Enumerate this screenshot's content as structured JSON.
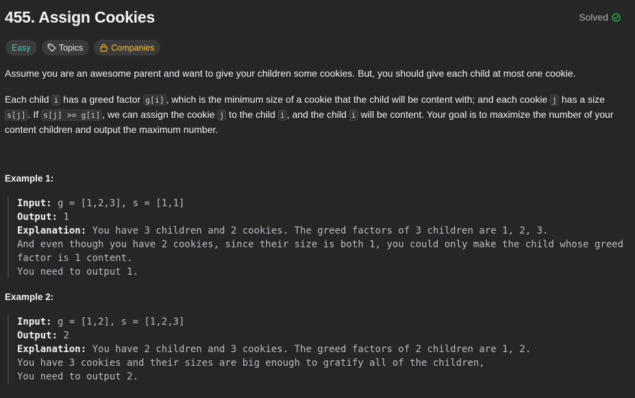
{
  "problem": {
    "title": "455. Assign Cookies",
    "status": "Solved",
    "colors": {
      "easy": "#46c6c2",
      "companies": "#ffc01e",
      "solved_check": "#2cbb5d"
    }
  },
  "tags": {
    "difficulty": "Easy",
    "topics": "Topics",
    "companies": "Companies"
  },
  "description": {
    "p1": "Assume you are an awesome parent and want to give your children some cookies. But, you should give each child at most one cookie.",
    "p2": {
      "t1": "Each child ",
      "c1": "i",
      "t2": " has a greed factor ",
      "c2": "g[i]",
      "t3": ", which is the minimum size of a cookie that the child will be content with; and each cookie ",
      "c3": "j",
      "t4": " has a size ",
      "c4": "s[j]",
      "t5": ". If ",
      "c5": "s[j] >= g[i]",
      "t6": ", we can assign the cookie ",
      "c6": "j",
      "t7": " to the child ",
      "c7": "i",
      "t8": ", and the child ",
      "c8": "i",
      "t9": " will be content. Your goal is to maximize the number of your content children and output the maximum number."
    }
  },
  "examples": [
    {
      "title": "Example 1:",
      "input_label": "Input:",
      "input": " g = [1,2,3], s = [1,1]",
      "output_label": "Output:",
      "output": " 1",
      "explanation_label": "Explanation:",
      "explanation": [
        " You have 3 children and 2 cookies. The greed factors of 3 children are 1, 2, 3.",
        "And even though you have 2 cookies, since their size is both 1, you could only make the child whose greed factor is 1 content.",
        "You need to output 1."
      ]
    },
    {
      "title": "Example 2:",
      "input_label": "Input:",
      "input": " g = [1,2], s = [1,2,3]",
      "output_label": "Output:",
      "output": " 2",
      "explanation_label": "Explanation:",
      "explanation": [
        " You have 2 children and 3 cookies. The greed factors of 2 children are 1, 2.",
        "You have 3 cookies and their sizes are big enough to gratify all of the children,",
        "You need to output 2."
      ]
    }
  ]
}
